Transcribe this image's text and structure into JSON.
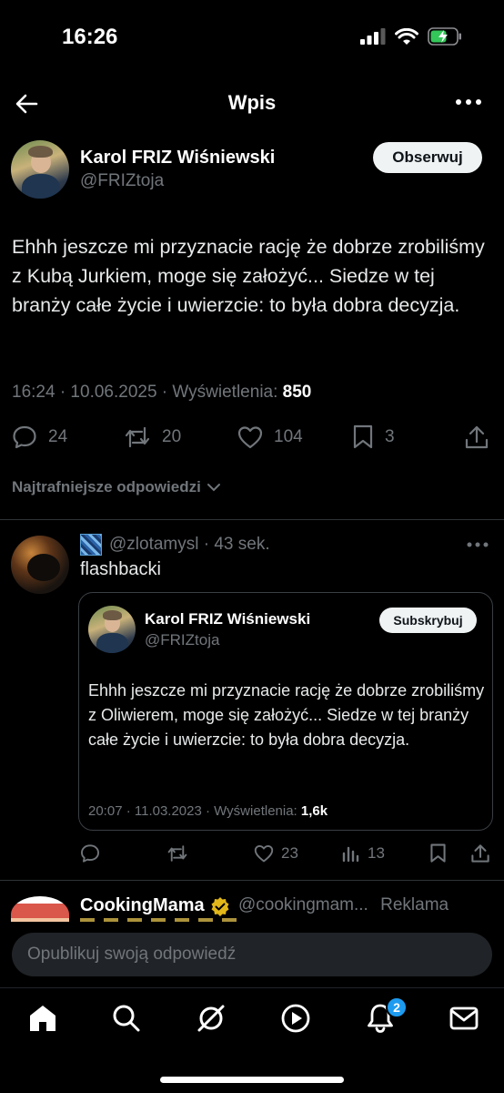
{
  "status_bar": {
    "time": "16:26"
  },
  "header": {
    "title": "Wpis"
  },
  "post": {
    "author_name": "Karol FRIZ Wiśniewski",
    "author_handle": "@FRIZtoja",
    "follow_label": "Obserwuj",
    "text": "Ehhh jeszcze mi przyznacie rację że dobrze zrobiliśmy z Kubą Jurkiem, moge się założyć... Siedze w tej branży całe życie i uwierzcie: to była dobra decyzja.",
    "meta_prefix": "16:24 · 10.06.2025 · Wyświetlenia: ",
    "views": "850",
    "replies": "24",
    "reposts": "20",
    "likes": "104",
    "bookmarks": "3"
  },
  "sort_label": "Najtrafniejsze odpowiedzi",
  "reply": {
    "handle_time": "@zlotamysl · 43 sek.",
    "text": "flashbacki",
    "quote": {
      "author_name": "Karol FRIZ Wiśniewski",
      "author_handle": "@FRIZtoja",
      "subscribe_label": "Subskrybuj",
      "text": "Ehhh jeszcze mi przyznacie rację że dobrze zrobiliśmy z Oliwierem, moge się założyć... Siedze w tej branży całe życie i uwierzcie: to była dobra decyzja.",
      "meta_prefix": "20:07 · 11.03.2023 · Wyświetlenia: ",
      "views": "1,6k"
    },
    "likes": "23",
    "views": "13"
  },
  "ad": {
    "name": "CookingMama",
    "handle": "@cookingmam...",
    "label": "Reklama"
  },
  "composer": {
    "placeholder": "Opublikuj swoją odpowiedź"
  },
  "bottom_nav": {
    "notifications_badge": "2"
  },
  "colors": {
    "accent": "#1d9bf0",
    "muted": "#71767b",
    "background": "#000000",
    "verified": "#e2b719"
  }
}
